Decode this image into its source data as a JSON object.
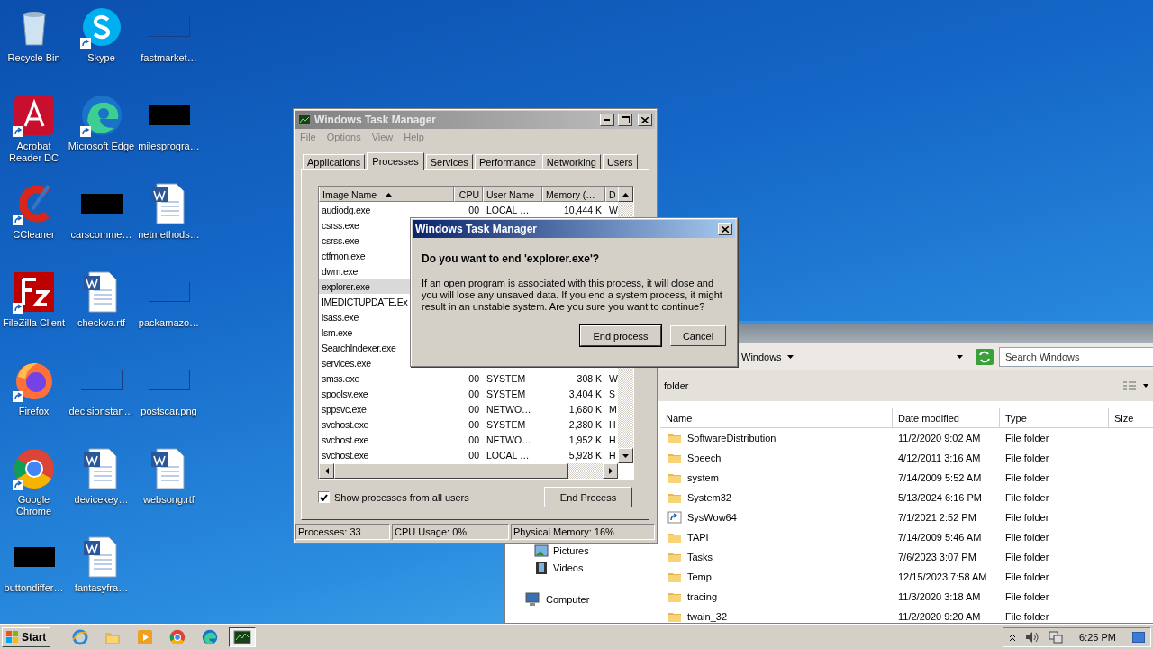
{
  "desktop_icons": [
    {
      "label": "Recycle Bin",
      "kind": "app",
      "shortcut": false
    },
    {
      "label": "Acrobat Reader DC",
      "kind": "app",
      "shortcut": true
    },
    {
      "label": "CCleaner",
      "kind": "app",
      "shortcut": true
    },
    {
      "label": "FileZilla Client",
      "kind": "app",
      "shortcut": true
    },
    {
      "label": "Firefox",
      "kind": "app",
      "shortcut": true
    },
    {
      "label": "Google Chrome",
      "kind": "app",
      "shortcut": true
    },
    {
      "label": "buttondiffer…",
      "kind": "redacted",
      "shortcut": false
    },
    {
      "label": "Skype",
      "kind": "app",
      "shortcut": true
    },
    {
      "label": "Microsoft Edge",
      "kind": "app",
      "shortcut": true
    },
    {
      "label": "carscomme…",
      "kind": "redacted",
      "shortcut": false
    },
    {
      "label": "checkva.rtf",
      "kind": "document",
      "shortcut": false
    },
    {
      "label": "decisionstan…",
      "kind": "blank",
      "shortcut": false
    },
    {
      "label": "devicekey…",
      "kind": "document",
      "shortcut": false
    },
    {
      "label": "fantasyfra…",
      "kind": "document",
      "shortcut": false
    },
    {
      "label": "fastmarket…",
      "kind": "blank",
      "shortcut": false
    },
    {
      "label": "milesprogra…",
      "kind": "redacted",
      "shortcut": false
    },
    {
      "label": "netmethods…",
      "kind": "document",
      "shortcut": false
    },
    {
      "label": "packamazo…",
      "kind": "blank",
      "shortcut": false
    },
    {
      "label": "postscar.png",
      "kind": "blank",
      "shortcut": false
    },
    {
      "label": "websong.rtf",
      "kind": "document",
      "shortcut": false
    }
  ],
  "explorer": {
    "address": "Windows",
    "search": {
      "placeholder": "Search Windows"
    },
    "toolbar_text": "folder",
    "nav_items": [
      {
        "label": "Pictures",
        "kind": "pictures"
      },
      {
        "label": "Videos",
        "kind": "videos"
      },
      {
        "label": "Computer",
        "kind": "computer"
      }
    ],
    "columns": [
      "Name",
      "Date modified",
      "Type",
      "Size"
    ],
    "rows": [
      {
        "name": "SoftwareDistribution",
        "date": "11/2/2020 9:02 AM",
        "type": "File folder",
        "kind": "folder"
      },
      {
        "name": "Speech",
        "date": "4/12/2011 3:16 AM",
        "type": "File folder",
        "kind": "folder"
      },
      {
        "name": "system",
        "date": "7/14/2009 5:52 AM",
        "type": "File folder",
        "kind": "folder"
      },
      {
        "name": "System32",
        "date": "5/13/2024 6:16 PM",
        "type": "File folder",
        "kind": "folder"
      },
      {
        "name": "SysWow64",
        "date": "7/1/2021 2:52 PM",
        "type": "File folder",
        "kind": "link"
      },
      {
        "name": "TAPI",
        "date": "7/14/2009 5:46 AM",
        "type": "File folder",
        "kind": "folder"
      },
      {
        "name": "Tasks",
        "date": "7/6/2023 3:07 PM",
        "type": "File folder",
        "kind": "folder"
      },
      {
        "name": "Temp",
        "date": "12/15/2023 7:58 AM",
        "type": "File folder",
        "kind": "folder"
      },
      {
        "name": "tracing",
        "date": "11/3/2020 3:18 AM",
        "type": "File folder",
        "kind": "folder"
      },
      {
        "name": "twain_32",
        "date": "11/2/2020 9:20 AM",
        "type": "File folder",
        "kind": "folder"
      }
    ]
  },
  "task_manager": {
    "title": "Windows Task Manager",
    "menu": [
      "File",
      "Options",
      "View",
      "Help"
    ],
    "tabs": [
      {
        "label": "Applications",
        "selected": false
      },
      {
        "label": "Processes",
        "selected": true
      },
      {
        "label": "Services",
        "selected": false
      },
      {
        "label": "Performance",
        "selected": false
      },
      {
        "label": "Networking",
        "selected": false
      },
      {
        "label": "Users",
        "selected": false
      }
    ],
    "columns": [
      "Image Name",
      "CPU",
      "User Name",
      "Memory (…",
      "D"
    ],
    "rows": [
      {
        "name": "audiodg.exe",
        "cpu": "00",
        "user": "LOCAL …",
        "memory": "10,444 K",
        "desc": "W",
        "selected": false
      },
      {
        "name": "csrss.exe",
        "selected": false
      },
      {
        "name": "csrss.exe",
        "selected": false
      },
      {
        "name": "ctfmon.exe",
        "selected": false
      },
      {
        "name": "dwm.exe",
        "selected": false
      },
      {
        "name": "explorer.exe",
        "selected": true
      },
      {
        "name": "IMEDICTUPDATE.Ex",
        "selected": false
      },
      {
        "name": "lsass.exe",
        "selected": false
      },
      {
        "name": "lsm.exe",
        "selected": false
      },
      {
        "name": "SearchIndexer.exe",
        "selected": false
      },
      {
        "name": "services.exe",
        "selected": false
      },
      {
        "name": "smss.exe",
        "cpu": "00",
        "user": "SYSTEM",
        "memory": "308 K",
        "desc": "W",
        "selected": false
      },
      {
        "name": "spoolsv.exe",
        "cpu": "00",
        "user": "SYSTEM",
        "memory": "3,404 K",
        "desc": "S",
        "selected": false
      },
      {
        "name": "sppsvc.exe",
        "cpu": "00",
        "user": "NETWO…",
        "memory": "1,680 K",
        "desc": "M",
        "selected": false
      },
      {
        "name": "svchost.exe",
        "cpu": "00",
        "user": "SYSTEM",
        "memory": "2,380 K",
        "desc": "H",
        "selected": false
      },
      {
        "name": "svchost.exe",
        "cpu": "00",
        "user": "NETWO…",
        "memory": "1,952 K",
        "desc": "H",
        "selected": false
      },
      {
        "name": "svchost.exe",
        "cpu": "00",
        "user": "LOCAL …",
        "memory": "5,928 K",
        "desc": "H",
        "selected": false
      }
    ],
    "show_all_users": {
      "label": "Show processes from all users",
      "checked": true
    },
    "end_button": "End Process",
    "status": [
      "Processes: 33",
      "CPU Usage: 0%",
      "Physical Memory: 16%"
    ]
  },
  "dialog": {
    "title": "Windows Task Manager",
    "heading": "Do you want to end 'explorer.exe'?",
    "message": "If an open program is associated with this process, it will close and you will lose any unsaved data. If you end a system process, it might result in an unstable system. Are you sure you want to continue?",
    "buttons": [
      "End process",
      "Cancel"
    ]
  },
  "taskbar": {
    "start": "Start",
    "apps": [
      {
        "active": false
      },
      {
        "active": false
      },
      {
        "active": false
      },
      {
        "active": false
      },
      {
        "active": false
      },
      {
        "active": true
      }
    ],
    "clock": "6:25 PM"
  }
}
